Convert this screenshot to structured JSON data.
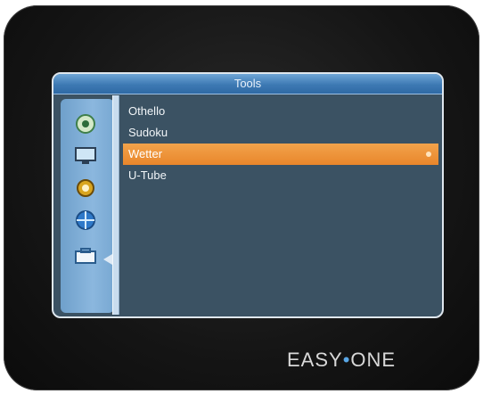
{
  "window": {
    "title": "Tools"
  },
  "sidebar": {
    "icons": [
      {
        "icon": "disc-icon",
        "selected": false
      },
      {
        "icon": "monitor-icon",
        "selected": false
      },
      {
        "icon": "gear-icon",
        "selected": false
      },
      {
        "icon": "globe-icon",
        "selected": false
      },
      {
        "icon": "toolbox-icon",
        "selected": true
      }
    ]
  },
  "menu": {
    "items": [
      {
        "label": "Othello",
        "selected": false
      },
      {
        "label": "Sudoku",
        "selected": false
      },
      {
        "label": "Wetter",
        "selected": true
      },
      {
        "label": "U-Tube",
        "selected": false
      }
    ]
  },
  "brand": {
    "left": "EASY",
    "separator": "•",
    "right": "ONE"
  },
  "colors": {
    "screen_bg": "#3b5263",
    "title_bar": "#3d79b3",
    "highlight": "#e9862b",
    "sidebar": "#8bb7de"
  }
}
